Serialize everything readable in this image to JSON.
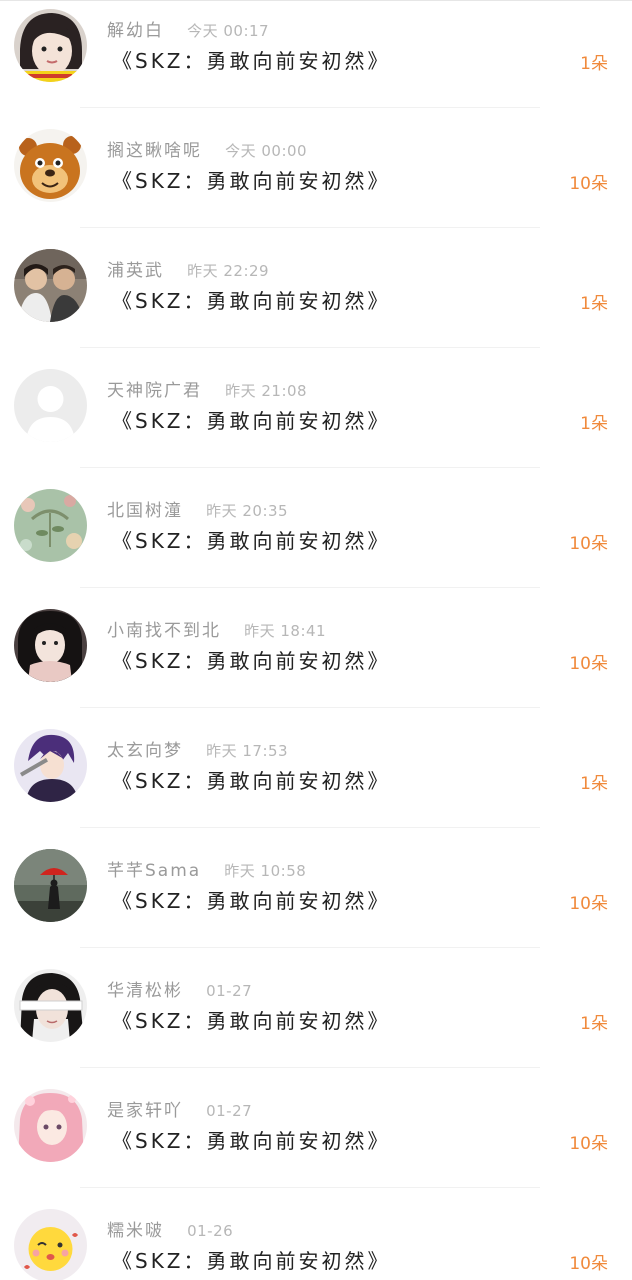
{
  "accent_color": "#f08a3c",
  "gifts": [
    {
      "name": "解幼白",
      "time": "今天 00:17",
      "gift": "《SKZ：勇敢向前安初然》",
      "count": "1朵",
      "avatar": "girl-photo-avatar"
    },
    {
      "name": "搁这瞅啥呢",
      "time": "今天 00:00",
      "gift": "《SKZ：勇敢向前安初然》",
      "count": "10朵",
      "avatar": "cartoon-bear-avatar"
    },
    {
      "name": "浦英武",
      "time": "昨天 22:29",
      "gift": "《SKZ：勇敢向前安初然》",
      "count": "1朵",
      "avatar": "couple-photo-avatar"
    },
    {
      "name": "天神院广君",
      "time": "昨天 21:08",
      "gift": "《SKZ：勇敢向前安初然》",
      "count": "1朵",
      "avatar": "default-avatar"
    },
    {
      "name": "北国树潼",
      "time": "昨天 20:35",
      "gift": "《SKZ：勇敢向前安初然》",
      "count": "10朵",
      "avatar": "floral-pattern-avatar"
    },
    {
      "name": "小南找不到北",
      "time": "昨天 18:41",
      "gift": "《SKZ：勇敢向前安初然》",
      "count": "10朵",
      "avatar": "girl-scarf-avatar"
    },
    {
      "name": "太玄向梦",
      "time": "昨天 17:53",
      "gift": "《SKZ：勇敢向前安初然》",
      "count": "1朵",
      "avatar": "anime-boy-avatar"
    },
    {
      "name": "芊芊Sama",
      "time": "昨天 10:58",
      "gift": "《SKZ：勇敢向前安初然》",
      "count": "10朵",
      "avatar": "umbrella-avatar"
    },
    {
      "name": "华清松彬",
      "time": "01-27",
      "gift": "《SKZ：勇敢向前安初然》",
      "count": "1朵",
      "avatar": "blindfold-girl-avatar"
    },
    {
      "name": "是家轩吖",
      "time": "01-27",
      "gift": "《SKZ：勇敢向前安初然》",
      "count": "10朵",
      "avatar": "pink-hair-avatar"
    },
    {
      "name": "糯米啵",
      "time": "01-26",
      "gift": "《SKZ：勇敢向前安初然》",
      "count": "10朵",
      "avatar": "cute-emoji-avatar"
    }
  ]
}
